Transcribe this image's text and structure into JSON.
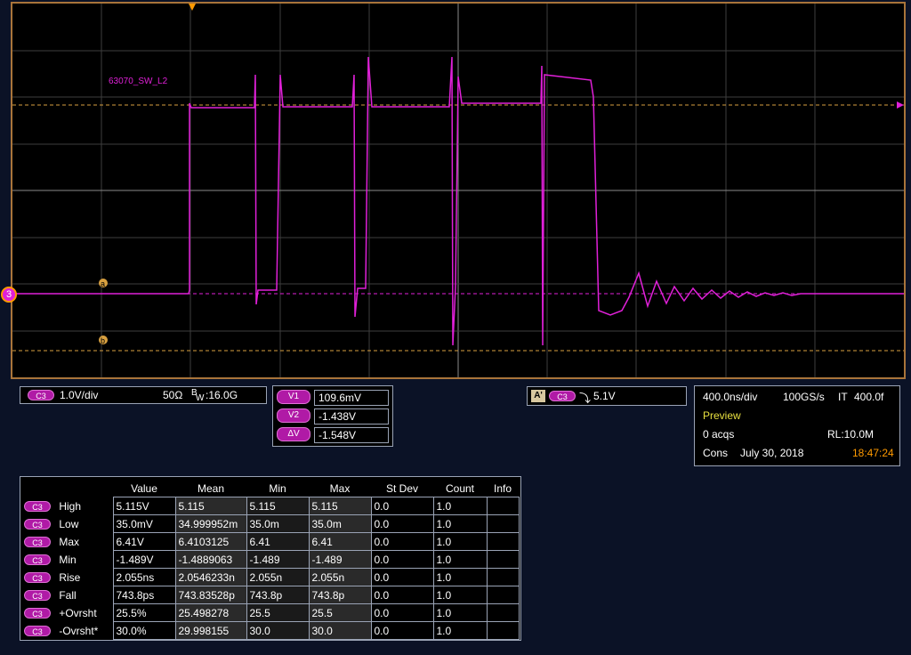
{
  "waveform": {
    "label": "63070_SW_L2",
    "channel_marker": "3",
    "cursor_a": "a",
    "cursor_b": "b",
    "trace_color": "#e020d8",
    "grid_color": "#7a7a7a",
    "cursor_line_color": "#d8a040"
  },
  "channel": {
    "tag": "C3",
    "scale": "1.0V/div",
    "impedance": "50Ω",
    "bw_prefix": "B",
    "bw_sub": "W",
    "bw": ":16.0G"
  },
  "cursors": [
    {
      "tag": "V1",
      "value": "109.6mV"
    },
    {
      "tag": "V2",
      "value": "-1.438V"
    },
    {
      "tag": "ΔV",
      "value": "-1.548V"
    }
  ],
  "trigger": {
    "mode_icon": "A'",
    "tag": "C3",
    "slope_symbol": "⤵",
    "level": "5.1V"
  },
  "acquisition": {
    "time_div": "400.0ns/div",
    "sample_rate": "100GS/s",
    "it": "IT",
    "it_value": "400.0f",
    "status": "Preview",
    "acqs": "0 acqs",
    "rl": "RL:10.0M",
    "mode": "Cons",
    "date": "July 30, 2018",
    "time": "18:47:24"
  },
  "measurements": {
    "headers": [
      "Value",
      "Mean",
      "Min",
      "Max",
      "St Dev",
      "Count",
      "Info"
    ],
    "rows": [
      {
        "tag": "C3",
        "name": "High",
        "value": "5.115V",
        "mean": "5.115",
        "min": "5.115",
        "max": "5.115",
        "stdev": "0.0",
        "count": "1.0",
        "info": ""
      },
      {
        "tag": "C3",
        "name": "Low",
        "value": "35.0mV",
        "mean": "34.999952m",
        "min": "35.0m",
        "max": "35.0m",
        "stdev": "0.0",
        "count": "1.0",
        "info": ""
      },
      {
        "tag": "C3",
        "name": "Max",
        "value": "6.41V",
        "mean": "6.4103125",
        "min": "6.41",
        "max": "6.41",
        "stdev": "0.0",
        "count": "1.0",
        "info": ""
      },
      {
        "tag": "C3",
        "name": "Min",
        "value": "-1.489V",
        "mean": "-1.4889063",
        "min": "-1.489",
        "max": "-1.489",
        "stdev": "0.0",
        "count": "1.0",
        "info": ""
      },
      {
        "tag": "C3",
        "name": "Rise",
        "value": "2.055ns",
        "mean": "2.0546233n",
        "min": "2.055n",
        "max": "2.055n",
        "stdev": "0.0",
        "count": "1.0",
        "info": ""
      },
      {
        "tag": "C3",
        "name": "Fall",
        "value": "743.8ps",
        "mean": "743.83528p",
        "min": "743.8p",
        "max": "743.8p",
        "stdev": "0.0",
        "count": "1.0",
        "info": ""
      },
      {
        "tag": "C3",
        "name": "+Ovrsht",
        "value": "25.5%",
        "mean": "25.498278",
        "min": "25.5",
        "max": "25.5",
        "stdev": "0.0",
        "count": "1.0",
        "info": ""
      },
      {
        "tag": "C3",
        "name": "-Ovrsht*",
        "value": "30.0%",
        "mean": "29.998155",
        "min": "30.0",
        "max": "30.0",
        "stdev": "0.0",
        "count": "1.0",
        "info": ""
      }
    ]
  }
}
